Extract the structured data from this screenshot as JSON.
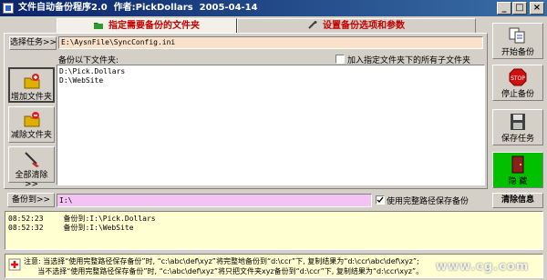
{
  "window": {
    "title": "文件自动备份程序2.0  作者:PickDollars  2005-04-14",
    "minimize": "_",
    "maximize": "□",
    "close": "×"
  },
  "tabs": [
    {
      "label": "指定需要备份的文件夹",
      "active": true
    },
    {
      "label": "设置备份选项和参数",
      "active": false
    }
  ],
  "task": {
    "button": "选择任务>>",
    "path": "E:\\AysnFile\\SyncConfig.ini"
  },
  "folders": {
    "label": "备份以下文件夹:",
    "include_subfolders_label": "加入指定文件夹下的所有子文件夹",
    "include_subfolders": false,
    "items": [
      "D:\\Pick.Dollars",
      "D:\\WebSite"
    ]
  },
  "left_buttons": {
    "add": "增加文件夹",
    "remove": "减除文件夹",
    "clear_all": "全部清除>>"
  },
  "right_buttons": {
    "start": "开始备份",
    "stop": "停止备份",
    "save": "保存任务",
    "hide": "隐 藏",
    "clear_info": "清除信息"
  },
  "backup_to": {
    "button": "备份到>>",
    "path": "I:\\",
    "use_full_path_label": "使用完整路径保存备份",
    "use_full_path": true
  },
  "log": [
    {
      "time": "08:52:23",
      "message": "备份到:I:\\Pick.Dollars"
    },
    {
      "time": "08:52:32",
      "message": "备份到:I:\\WebSite"
    }
  ],
  "note": {
    "line1": "注意: 当选择“使用完整路径保存备份”时, “c:\\abc\\def\\xyz”将完整地备份到“d:\\ccr”下, 复制结果为“d:\\ccr\\abc\\def\\xyz”;",
    "line2": "      当不选择“使用完整路径保存备份”时, “c:\\abc\\def\\xyz”将只把文件夹xyz备份到“d:\\ccr”下, 复制结果为“d:\\ccr\\xyz”。"
  },
  "watermark": "www.cg.com",
  "colors": {
    "title_bar": "#0a246a",
    "tab_text": "#c00000",
    "task_field": "#f9e2c9",
    "backup_field": "#f4c3f4",
    "log_bg": "#ffffd2",
    "hide_button": "#00c000"
  }
}
